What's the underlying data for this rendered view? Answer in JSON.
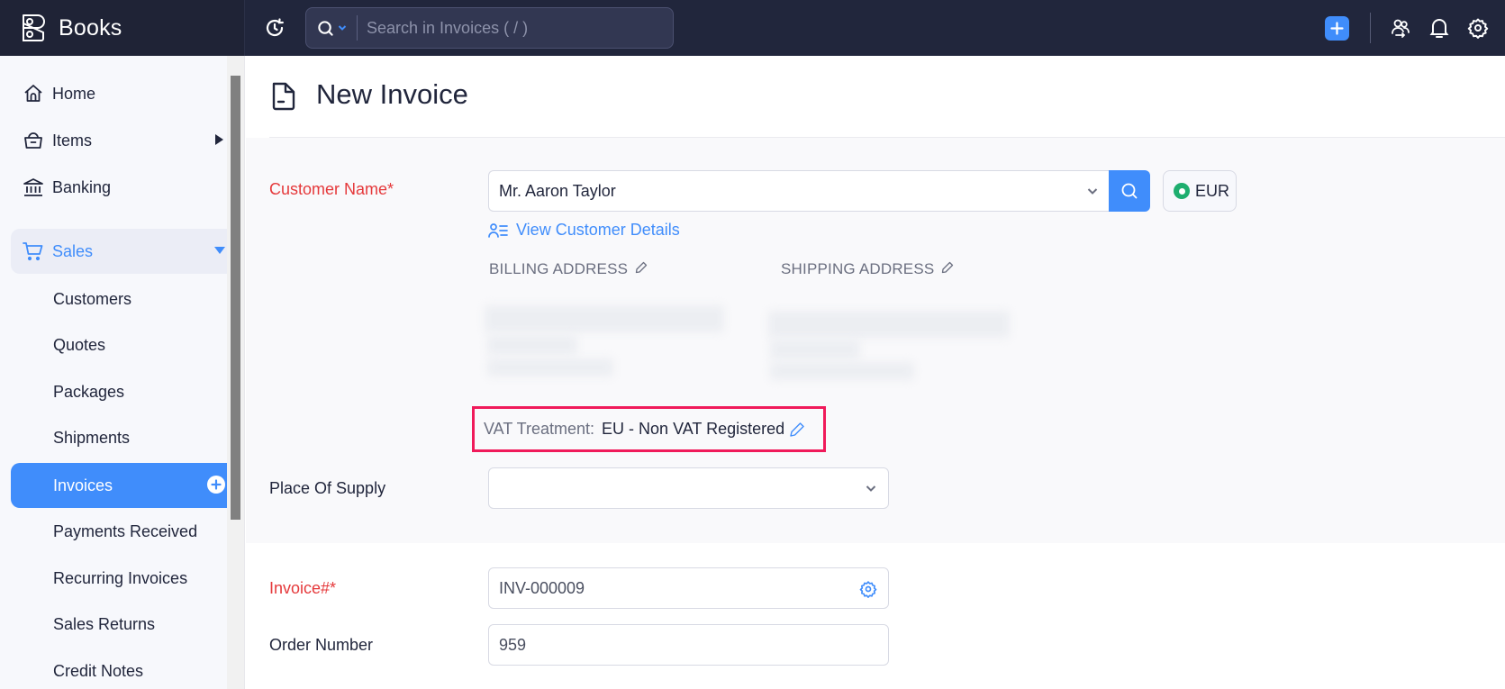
{
  "app": {
    "name": "Books",
    "search_placeholder": "Search in Invoices ( / )"
  },
  "topbar": {
    "icons": [
      "recent-activity-icon",
      "search-icon",
      "plus-icon",
      "refer-users-icon",
      "bell-icon",
      "gear-icon"
    ]
  },
  "sidebar": {
    "items": [
      {
        "label": "Home",
        "icon": "home-icon"
      },
      {
        "label": "Items",
        "icon": "basket-icon",
        "has_submenu": true
      },
      {
        "label": "Banking",
        "icon": "bank-icon"
      },
      {
        "label": "Sales",
        "icon": "cart-icon",
        "expanded": true
      }
    ],
    "sales_children": [
      {
        "label": "Customers"
      },
      {
        "label": "Quotes"
      },
      {
        "label": "Packages"
      },
      {
        "label": "Shipments"
      },
      {
        "label": "Invoices",
        "active": true
      },
      {
        "label": "Payments Received"
      },
      {
        "label": "Recurring Invoices"
      },
      {
        "label": "Sales Returns"
      },
      {
        "label": "Credit Notes"
      }
    ]
  },
  "page": {
    "title": "New Invoice"
  },
  "form": {
    "customer_name_label": "Customer Name*",
    "customer_name_value": "Mr. Aaron Taylor",
    "currency": "EUR",
    "view_customer_details": "View Customer Details",
    "billing_address_label": "BILLING ADDRESS",
    "shipping_address_label": "SHIPPING ADDRESS",
    "vat_treatment_label": "VAT Treatment:",
    "vat_treatment_value": "EU - Non VAT Registered",
    "place_of_supply_label": "Place Of Supply",
    "place_of_supply_value": "",
    "invoice_number_label": "Invoice#*",
    "invoice_number_value": "INV-000009",
    "order_number_label": "Order Number",
    "order_number_value": "959"
  },
  "colors": {
    "accent": "#408dfb",
    "topbar": "#21263c",
    "required": "#e5393b",
    "highlight_border": "#f01a5a",
    "currency_dot": "#1eae6f"
  }
}
